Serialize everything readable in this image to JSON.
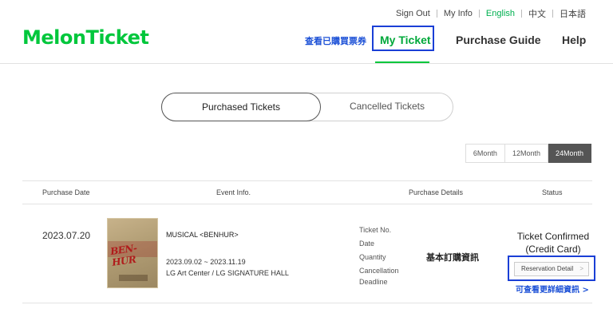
{
  "header": {
    "logo": "MelonTicket",
    "util_nav": {
      "sign_out": "Sign Out",
      "my_info": "My Info",
      "english": "English",
      "chinese": "中文",
      "japanese": "日本語"
    },
    "main_nav": {
      "my_ticket": "My Ticket",
      "purchase_guide": "Purchase Guide",
      "help": "Help"
    },
    "note_view_purchased": "查看已購買票券"
  },
  "tabs": {
    "purchased": "Purchased Tickets",
    "cancelled": "Cancelled Tickets"
  },
  "period": {
    "options": [
      "6Month",
      "12Month",
      "24Month"
    ],
    "selected": "24Month"
  },
  "table": {
    "headers": {
      "date": "Purchase Date",
      "event": "Event Info.",
      "details": "Purchase Details",
      "status": "Status"
    },
    "rows": [
      {
        "date": "2023.07.20",
        "poster_text": "BEN-HUR",
        "event_title": "MUSICAL <BENHUR>",
        "event_dates": "2023.09.02 ~ 2023.11.19",
        "event_venue": "LG Art Center / LG SIGNATURE HALL",
        "detail_labels": {
          "ticket_no": "Ticket No.",
          "date": "Date",
          "quantity": "Quantity",
          "cancellation_1": "Cancellation",
          "cancellation_2": "Deadline"
        },
        "note_basic": "基本訂購資訊",
        "status_line1": "Ticket Confirmed",
        "status_line2": "(Credit Card)",
        "detail_button": "Reservation Detail",
        "detail_chevron": ">",
        "note_more": "可查看更詳細資訊 >"
      }
    ]
  },
  "colors": {
    "brand_green": "#00c73c",
    "annotation_blue": "#1a3fd6",
    "active_period": "#555555"
  }
}
